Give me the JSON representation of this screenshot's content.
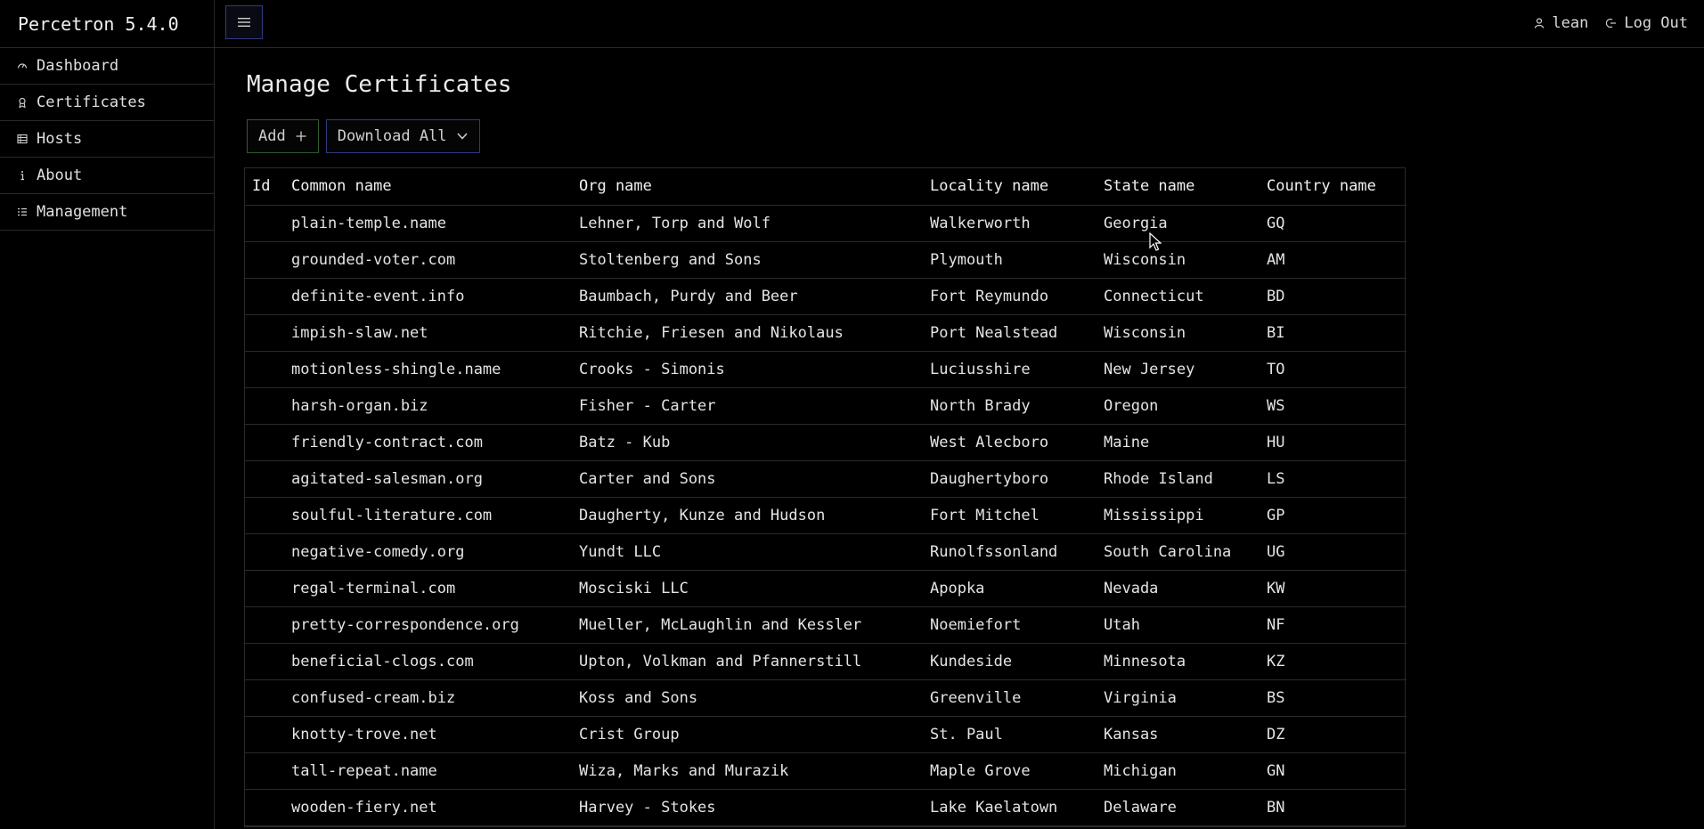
{
  "app": {
    "title": "Percetron 5.4.0"
  },
  "topbar": {
    "menu_icon": "hamburger-icon",
    "user_label": "lean",
    "logout_label": "Log Out"
  },
  "sidebar": {
    "items": [
      {
        "label": "Dashboard",
        "icon": "dashboard-icon"
      },
      {
        "label": "Certificates",
        "icon": "certificate-icon"
      },
      {
        "label": "Hosts",
        "icon": "hosts-icon"
      },
      {
        "label": "About",
        "icon": "info-icon"
      },
      {
        "label": "Management",
        "icon": "management-icon"
      }
    ]
  },
  "main": {
    "title": "Manage Certificates",
    "add_label": "Add",
    "download_label": "Download All"
  },
  "table": {
    "headers": [
      "Id",
      "Common name",
      "Org name",
      "Locality name",
      "State name",
      "Country name"
    ],
    "rows": [
      [
        "",
        "plain-temple.name",
        "Lehner, Torp and Wolf",
        "Walkerworth",
        "Georgia",
        "GQ"
      ],
      [
        "",
        "grounded-voter.com",
        "Stoltenberg and Sons",
        "Plymouth",
        "Wisconsin",
        "AM"
      ],
      [
        "",
        "definite-event.info",
        "Baumbach, Purdy and Beer",
        "Fort Reymundo",
        "Connecticut",
        "BD"
      ],
      [
        "",
        "impish-slaw.net",
        "Ritchie, Friesen and Nikolaus",
        "Port Nealstead",
        "Wisconsin",
        "BI"
      ],
      [
        "",
        "motionless-shingle.name",
        "Crooks - Simonis",
        "Luciusshire",
        "New Jersey",
        "TO"
      ],
      [
        "",
        "harsh-organ.biz",
        "Fisher - Carter",
        "North Brady",
        "Oregon",
        "WS"
      ],
      [
        "",
        "friendly-contract.com",
        "Batz - Kub",
        "West Alecboro",
        "Maine",
        "HU"
      ],
      [
        "",
        "agitated-salesman.org",
        "Carter and Sons",
        "Daughertyboro",
        "Rhode Island",
        "LS"
      ],
      [
        "",
        "soulful-literature.com",
        "Daugherty, Kunze and Hudson",
        "Fort Mitchel",
        "Mississippi",
        "GP"
      ],
      [
        "",
        "negative-comedy.org",
        "Yundt LLC",
        "Runolfssonland",
        "South Carolina",
        "UG"
      ],
      [
        "",
        "regal-terminal.com",
        "Mosciski LLC",
        "Apopka",
        "Nevada",
        "KW"
      ],
      [
        "",
        "pretty-correspondence.org",
        "Mueller, McLaughlin and Kessler",
        "Noemiefort",
        "Utah",
        "NF"
      ],
      [
        "",
        "beneficial-clogs.com",
        "Upton, Volkman and Pfannerstill",
        "Kundeside",
        "Minnesota",
        "KZ"
      ],
      [
        "",
        "confused-cream.biz",
        "Koss and Sons",
        "Greenville",
        "Virginia",
        "BS"
      ],
      [
        "",
        "knotty-trove.net",
        "Crist Group",
        "St. Paul",
        "Kansas",
        "DZ"
      ],
      [
        "",
        "tall-repeat.name",
        "Wiza, Marks and Murazik",
        "Maple Grove",
        "Michigan",
        "GN"
      ],
      [
        "",
        "wooden-fiery.net",
        "Harvey - Stokes",
        "Lake Kaelatown",
        "Delaware",
        "BN"
      ]
    ]
  },
  "colors": {
    "background": "#000000",
    "border": "#2a2a2a",
    "accent_blue": "#2f3a80",
    "accent_green": "#2e5a2e"
  }
}
